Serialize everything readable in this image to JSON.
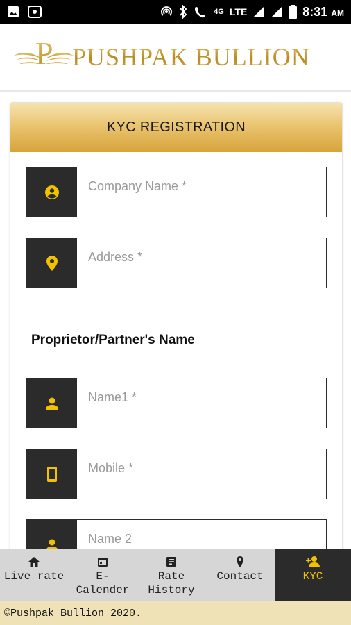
{
  "status_bar": {
    "time": "8:31",
    "ampm": "AM",
    "network": "LTE",
    "network_small": "4G"
  },
  "header": {
    "brand": "PUSHPAK BULLION"
  },
  "form": {
    "title": "KYC REGISTRATION",
    "company_placeholder": "Company Name *",
    "address_placeholder": "Address *",
    "section_label": "Proprietor/Partner's Name",
    "name1_placeholder": "Name1 *",
    "mobile_placeholder": "Mobile *",
    "name2_placeholder": "Name 2"
  },
  "nav": {
    "items": [
      {
        "label_1": "Live rate",
        "label_2": "",
        "icon": "home-icon"
      },
      {
        "label_1": "E-",
        "label_2": "Calender",
        "icon": "calendar-icon"
      },
      {
        "label_1": "Rate",
        "label_2": "History",
        "icon": "list-icon"
      },
      {
        "label_1": "Contact",
        "label_2": "",
        "icon": "location-pin-icon"
      },
      {
        "label_1": "KYC",
        "label_2": "",
        "icon": "add-person-icon"
      }
    ]
  },
  "footer": {
    "text": "©Pushpak Bullion 2020."
  },
  "colors": {
    "accent_gold": "#f2c200",
    "header_gold": "#d8a33a",
    "dark": "#2b2b2b"
  }
}
